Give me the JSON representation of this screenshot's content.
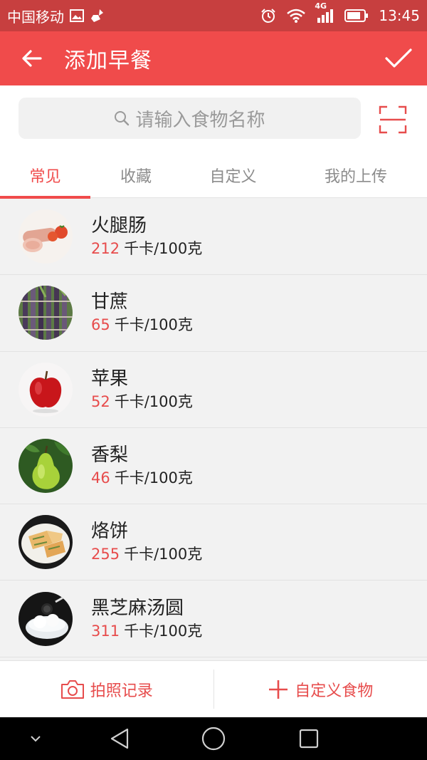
{
  "status_bar": {
    "carrier": "中国移动",
    "network": "4G",
    "time": "13:45"
  },
  "header": {
    "title": "添加早餐"
  },
  "search": {
    "placeholder": "请输入食物名称"
  },
  "tabs": [
    {
      "label": "常见",
      "active": true
    },
    {
      "label": "收藏",
      "active": false
    },
    {
      "label": "自定义",
      "active": false
    },
    {
      "label": "我的上传",
      "active": false
    }
  ],
  "foods": [
    {
      "name": "火腿肠",
      "calories": "212",
      "unit": "千卡/100克",
      "icon": "ham-sausage"
    },
    {
      "name": "甘蔗",
      "calories": "65",
      "unit": "千卡/100克",
      "icon": "sugarcane"
    },
    {
      "name": "苹果",
      "calories": "52",
      "unit": "千卡/100克",
      "icon": "apple"
    },
    {
      "name": "香梨",
      "calories": "46",
      "unit": "千卡/100克",
      "icon": "pear"
    },
    {
      "name": "烙饼",
      "calories": "255",
      "unit": "千卡/100克",
      "icon": "pancake"
    },
    {
      "name": "黑芝麻汤圆",
      "calories": "311",
      "unit": "千卡/100克",
      "icon": "sesame-dumplings"
    }
  ],
  "bottom": {
    "photo_label": "拍照记录",
    "custom_label": "自定义食物"
  },
  "colors": {
    "accent": "#f04b4b",
    "status_bar": "#c73f3f",
    "calorie_number": "#e74c4c"
  }
}
